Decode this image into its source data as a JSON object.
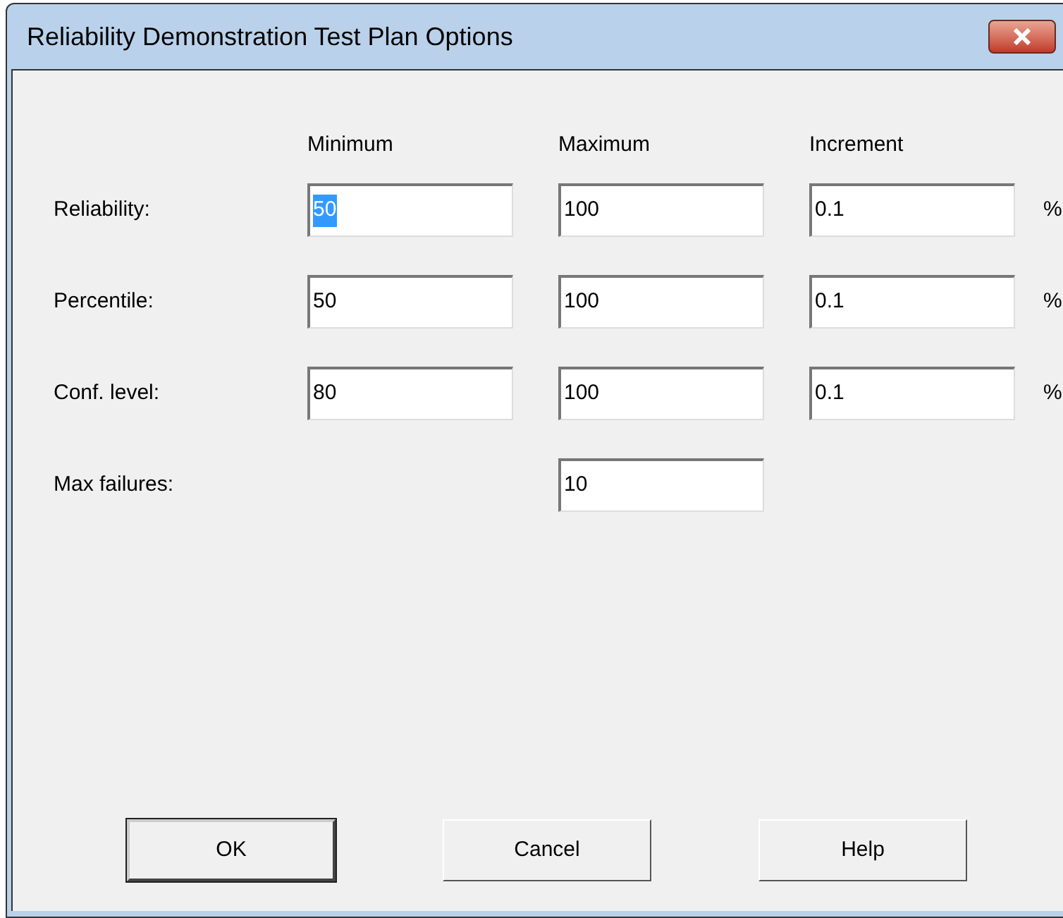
{
  "window": {
    "title": "Reliability Demonstration Test Plan Options"
  },
  "columns": [
    "Minimum",
    "Maximum",
    "Increment"
  ],
  "rows": [
    {
      "label": "Reliability:",
      "fields": [
        {
          "value": "50",
          "selected": true
        },
        {
          "value": "100",
          "selected": false
        },
        {
          "value": "0.1",
          "selected": false
        }
      ],
      "unit": "%"
    },
    {
      "label": "Percentile:",
      "fields": [
        {
          "value": "50",
          "selected": false
        },
        {
          "value": "100",
          "selected": false
        },
        {
          "value": "0.1",
          "selected": false
        }
      ],
      "unit": "%"
    },
    {
      "label": "Conf. level:",
      "fields": [
        {
          "value": "80",
          "selected": false
        },
        {
          "value": "100",
          "selected": false
        },
        {
          "value": "0.1",
          "selected": false
        }
      ],
      "unit": "%"
    },
    {
      "label": "Max failures:",
      "kind": "single",
      "fields": [
        {
          "value": "10",
          "selected": false
        }
      ]
    }
  ],
  "buttons": [
    {
      "label": "OK",
      "default": true
    },
    {
      "label": "Cancel",
      "default": false
    },
    {
      "label": "Help",
      "default": false
    }
  ]
}
